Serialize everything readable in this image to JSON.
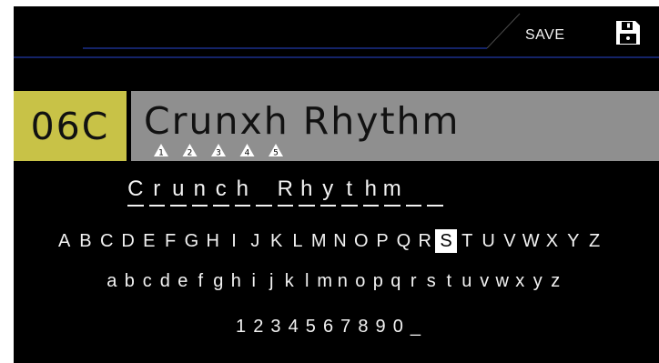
{
  "header": {
    "save_label": "SAVE",
    "save_icon": "floppy-disk-icon"
  },
  "preset": {
    "number": "06C",
    "name": "Crunxh Rhythm",
    "markers": [
      "1",
      "2",
      "3",
      "4",
      "5"
    ]
  },
  "editor": {
    "slots": [
      "C",
      "r",
      "u",
      "n",
      "c",
      "h",
      "_",
      "R",
      "h",
      "y",
      "t",
      "h",
      "m",
      "_",
      "_"
    ],
    "uppercase": [
      "A",
      "B",
      "C",
      "D",
      "E",
      "F",
      "G",
      "H",
      "I",
      "J",
      "K",
      "L",
      "M",
      "N",
      "O",
      "P",
      "Q",
      "R",
      "S",
      "T",
      "U",
      "V",
      "W",
      "X",
      "Y",
      "Z"
    ],
    "lowercase": [
      "a",
      "b",
      "c",
      "d",
      "e",
      "f",
      "g",
      "h",
      "i",
      "j",
      "k",
      "l",
      "m",
      "n",
      "o",
      "p",
      "q",
      "r",
      "s",
      "t",
      "u",
      "v",
      "w",
      "x",
      "y",
      "z"
    ],
    "digits": [
      "1",
      "2",
      "3",
      "4",
      "5",
      "6",
      "7",
      "8",
      "9",
      "0",
      "_"
    ],
    "selected_char": "S"
  },
  "colors": {
    "background": "#000000",
    "accent_line": "#1a2f8a",
    "preset_number_bg": "#c8c247",
    "preset_name_bg": "#8f8f8f",
    "text": "#f2f2f2"
  }
}
